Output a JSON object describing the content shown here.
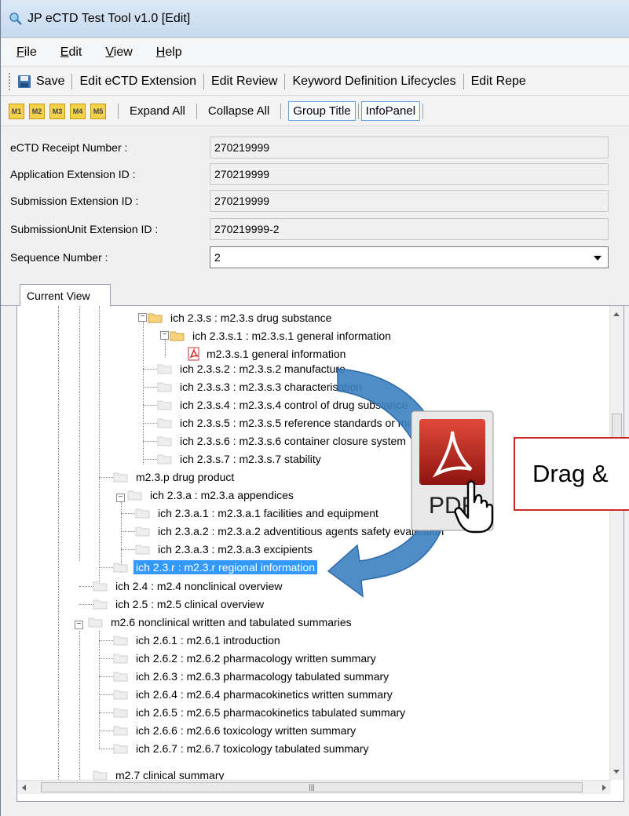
{
  "window": {
    "title": "JP eCTD Test Tool v1.0 [Edit]"
  },
  "menu": [
    {
      "label": "File",
      "underline": "F"
    },
    {
      "label": "Edit",
      "underline": "E"
    },
    {
      "label": "View",
      "underline": "V"
    },
    {
      "label": "Help",
      "underline": "H"
    }
  ],
  "toolbar1": {
    "save": "Save",
    "edit_ectd_extension": "Edit eCTD Extension",
    "edit_review": "Edit Review",
    "keyword_lifecycles": "Keyword Definition Lifecycles",
    "edit_repe": "Edit Repe"
  },
  "toolbar2": {
    "module_buttons": [
      "M1",
      "M2",
      "M3",
      "M4",
      "M5"
    ],
    "expand_all": "Expand All",
    "collapse_all": "Collapse All",
    "group_title": "Group Title",
    "info_panel": "InfoPanel"
  },
  "form": {
    "receipt_label": "eCTD Receipt Number :",
    "receipt_value": "270219999",
    "app_ext_label": "Application Extension ID :",
    "app_ext_value": "270219999",
    "sub_ext_label": "Submission Extension ID :",
    "sub_ext_value": "270219999",
    "unit_ext_label": "SubmissionUnit Extension ID :",
    "unit_ext_value": "270219999-2",
    "seq_label": "Sequence Number :",
    "seq_value": "2"
  },
  "tabs": {
    "current_view": "Current View"
  },
  "tree": {
    "n1": "ich 2.3.s : m2.3.s drug substance",
    "n2": "ich 2.3.s.1 : m2.3.s.1 general information",
    "n3": "m2.3.s.1 general information",
    "n4": "ich 2.3.s.2 : m2.3.s.2 manufacture",
    "n5": "ich 2.3.s.3 : m2.3.s.3 characterisation",
    "n6": "ich 2.3.s.4 : m2.3.s.4 control of drug substance",
    "n7": "ich 2.3.s.5 : m2.3.s.5 reference standards or materials",
    "n8": "ich 2.3.s.6 : m2.3.s.6 container closure system",
    "n9": "ich 2.3.s.7 : m2.3.s.7 stability",
    "n10": "m2.3.p drug product",
    "n11": "ich 2.3.a : m2.3.a appendices",
    "n12": "ich 2.3.a.1 : m2.3.a.1 facilities and equipment",
    "n13": "ich 2.3.a.2 : m2.3.a.2 adventitious agents safety evaluation",
    "n14": "ich 2.3.a.3 : m2.3.a.3 excipients",
    "n15": "ich 2.3.r : m2.3.r regional information",
    "n16": "ich 2.4 : m2.4 nonclinical overview",
    "n17": "ich 2.5 : m2.5 clinical overview",
    "n18": "m2.6 nonclinical written and tabulated summaries",
    "n19": "ich 2.6.1 : m2.6.1 introduction",
    "n20": "ich 2.6.2 : m2.6.2 pharmacology written summary",
    "n21": "ich 2.6.3 : m2.6.3 pharmacology tabulated summary",
    "n22": "ich 2.6.4 : m2.6.4 pharmacokinetics written summary",
    "n23": "ich 2.6.5 : m2.6.5 pharmacokinetics tabulated summary",
    "n24": "ich 2.6.6 : m2.6.6 toxicology written summary",
    "n25": "ich 2.6.7 : m2.6.7 toxicology tabulated summary",
    "n26": "m2.7 clinical summary"
  },
  "overlay": {
    "callout": "Drag &",
    "pdf_label": "PDF",
    "arrow_color": "#3d7fc1",
    "callout_border": "#d0282a"
  },
  "colors": {
    "selection": "#3399ff",
    "module_button": "#f3d24a"
  }
}
